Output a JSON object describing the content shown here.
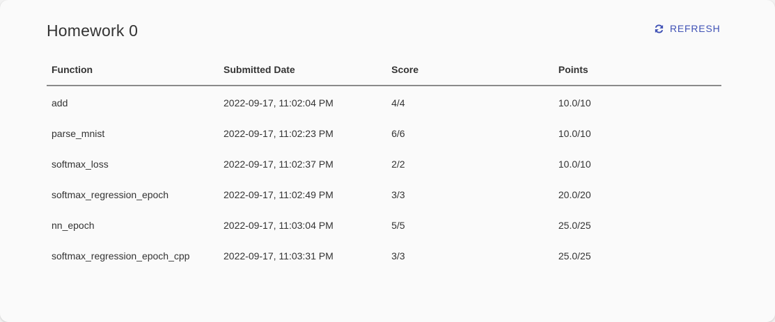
{
  "page": {
    "title": "Homework 0",
    "refresh_label": "REFRESH",
    "refresh_icon": "refresh-icon",
    "accent_color": "#3f51b5"
  },
  "table": {
    "headers": [
      "Function",
      "Submitted Date",
      "Score",
      "Points"
    ],
    "rows": [
      {
        "function": "add",
        "date": "2022-09-17, 11:02:04 PM",
        "score": "4/4",
        "points": "10.0/10"
      },
      {
        "function": "parse_mnist",
        "date": "2022-09-17, 11:02:23 PM",
        "score": "6/6",
        "points": "10.0/10"
      },
      {
        "function": "softmax_loss",
        "date": "2022-09-17, 11:02:37 PM",
        "score": "2/2",
        "points": "10.0/10"
      },
      {
        "function": "softmax_regression_epoch",
        "date": "2022-09-17, 11:02:49 PM",
        "score": "3/3",
        "points": "20.0/20"
      },
      {
        "function": "nn_epoch",
        "date": "2022-09-17, 11:03:04 PM",
        "score": "5/5",
        "points": "25.0/25"
      },
      {
        "function": "softmax_regression_epoch_cpp",
        "date": "2022-09-17, 11:03:31 PM",
        "score": "3/3",
        "points": "25.0/25"
      }
    ]
  }
}
